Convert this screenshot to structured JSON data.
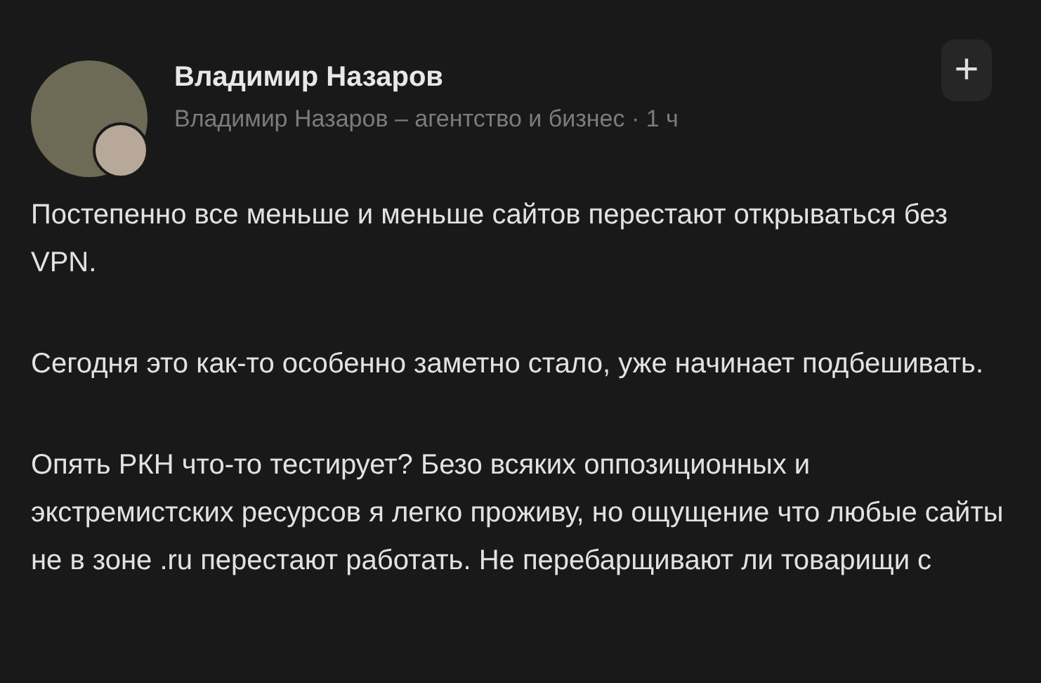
{
  "post": {
    "author": "Владимир Назаров",
    "source": "Владимир Назаров – агентство и бизнес · 1 ч",
    "add_button": "+",
    "paragraphs": [
      "Постепенно все меньше и меньше сайтов перестают открываться без VPN.",
      "Сегодня это как-то особенно заметно стало, уже начинает подбешивать.",
      "Опять РКН что-то тестирует? Безо всяких оппозиционных и экстремистских ресурсов я легко проживу, но ощущение что любые сайты не в зоне .ru перестают работать. Не перебарщивают ли товарищи с"
    ]
  }
}
